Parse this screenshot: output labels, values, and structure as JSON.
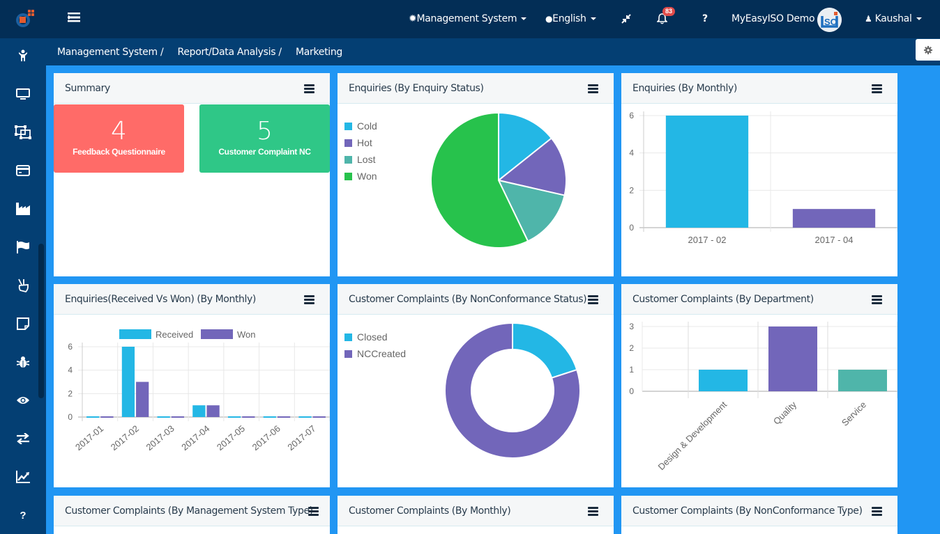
{
  "topbar": {
    "management_system_label": "Management System",
    "language_label": "English",
    "notification_count": "83",
    "help_label": "?",
    "company_name": "MyEasyISO Demo",
    "user_name": "Kaushal"
  },
  "breadcrumb": [
    {
      "label": "Management System",
      "sep": "/"
    },
    {
      "label": "Report/Data Analysis",
      "sep": "/"
    },
    {
      "label": "Marketing",
      "sep": ""
    }
  ],
  "sidebar": {
    "items": [
      {
        "icon": "person-icon"
      },
      {
        "icon": "monitor-icon"
      },
      {
        "icon": "object-group-icon"
      },
      {
        "icon": "credit-card-icon"
      },
      {
        "icon": "industry-icon"
      },
      {
        "icon": "flag-icon"
      },
      {
        "icon": "hand-peace-icon"
      },
      {
        "icon": "sticky-note-icon"
      },
      {
        "icon": "bug-icon"
      },
      {
        "icon": "eye-icon"
      },
      {
        "icon": "exchange-icon"
      },
      {
        "icon": "line-chart-icon"
      },
      {
        "icon": "question-icon"
      }
    ],
    "help_label": "?"
  },
  "colors": {
    "cyan": "#23b7e5",
    "purple": "#7266ba",
    "teal": "#4fb5aa",
    "green": "#27c24c",
    "red_tile": "#ff6b68",
    "green_tile": "#2fc787",
    "topbar": "#032e56",
    "sidebar": "#043f73",
    "content_bg": "#2196f3"
  },
  "panels": {
    "summary": {
      "title": "Summary",
      "tiles": [
        {
          "value": "4",
          "label": "Feedback Questionnaire"
        },
        {
          "value": "5",
          "label": "Customer Complaint NC"
        }
      ]
    },
    "enquiry_status": {
      "title": "Enquiries (By Enquiry Status)"
    },
    "enquiry_monthly": {
      "title": "Enquiries (By Monthly)"
    },
    "received_vs_won": {
      "title": "Enquiries(Received Vs Won) (By Monthly)"
    },
    "nc_status": {
      "title": "Customer Complaints (By NonConformance Status)"
    },
    "department": {
      "title": "Customer Complaints (By Department)"
    },
    "ms_type": {
      "title": "Customer Complaints (By Management System Type)"
    },
    "cc_monthly": {
      "title": "Customer Complaints (By Monthly)"
    },
    "nc_type": {
      "title": "Customer Complaints (By NonConformance Type)"
    }
  },
  "chart_data": [
    {
      "id": "enquiry_status",
      "type": "pie",
      "title": "Enquiries (By Enquiry Status)",
      "categories": [
        "Cold",
        "Hot",
        "Lost",
        "Won"
      ],
      "values": [
        1,
        1,
        1,
        4
      ],
      "colors": [
        "#23b7e5",
        "#7266ba",
        "#4fb5aa",
        "#27c24c"
      ],
      "legend": "top-left"
    },
    {
      "id": "enquiry_monthly",
      "type": "bar",
      "title": "Enquiries (By Monthly)",
      "categories": [
        "2017 - 02",
        "2017 - 04"
      ],
      "values": [
        6,
        1
      ],
      "colors": [
        "#23b7e5",
        "#7266ba"
      ],
      "yticks": [
        "0",
        "2",
        "4",
        "6"
      ],
      "ylim": [
        0,
        6
      ],
      "grid": true
    },
    {
      "id": "received_vs_won",
      "type": "bar",
      "title": "Enquiries(Received Vs Won) (By Monthly)",
      "categories": [
        "2017-01",
        "2017-02",
        "2017-03",
        "2017-04",
        "2017-05",
        "2017-06",
        "2017-07"
      ],
      "series": [
        {
          "name": "Received",
          "color": "#23b7e5",
          "values": [
            0,
            6,
            0,
            1,
            0,
            0,
            0
          ]
        },
        {
          "name": "Won",
          "color": "#7266ba",
          "values": [
            0,
            3,
            0,
            1,
            0,
            0,
            0
          ]
        }
      ],
      "yticks": [
        "0",
        "2",
        "4",
        "6"
      ],
      "ylim": [
        0,
        6
      ],
      "legend": "top",
      "grid": true
    },
    {
      "id": "nc_status",
      "type": "pie",
      "donut": true,
      "title": "Customer Complaints (By NonConformance Status)",
      "categories": [
        "Closed",
        "NCCreated"
      ],
      "values": [
        1,
        4
      ],
      "colors": [
        "#23b7e5",
        "#7266ba"
      ],
      "legend": "top-left"
    },
    {
      "id": "department",
      "type": "bar",
      "title": "Customer Complaints (By Department)",
      "categories": [
        "Design & Development",
        "Quality",
        "Service"
      ],
      "visible_tick_labels": [
        "sign & Development",
        "Quality",
        "Service"
      ],
      "values": [
        1,
        3,
        1
      ],
      "colors": [
        "#23b7e5",
        "#7266ba",
        "#4fb5aa"
      ],
      "yticks": [
        "0",
        "1",
        "2",
        "3"
      ],
      "ylim": [
        0,
        3
      ],
      "grid": true
    }
  ]
}
